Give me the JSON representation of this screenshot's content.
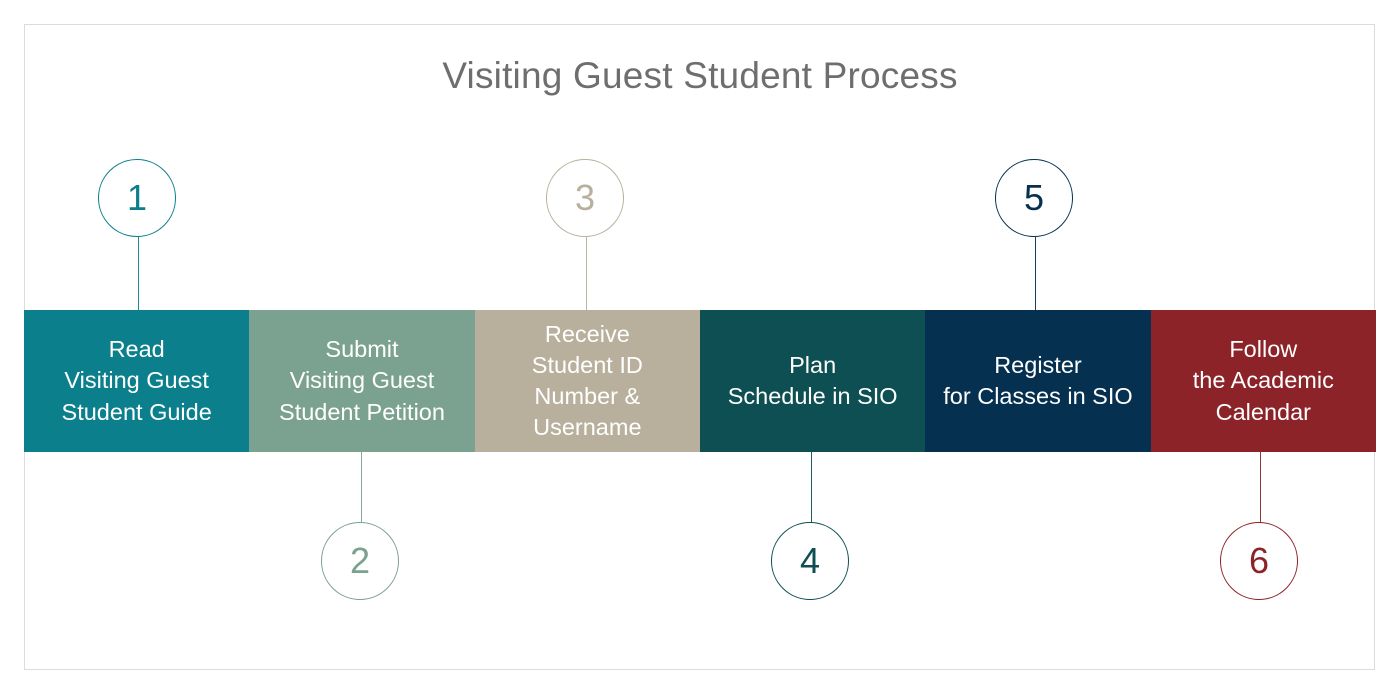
{
  "page": {
    "title": "Visiting Guest Student Process",
    "background": "#ffffff",
    "frame_border_color": "#dcdcdc",
    "title_color": "#6e6e6e"
  },
  "chart_data": {
    "type": "table",
    "title": "Visiting Guest Student Process",
    "steps": [
      {
        "number": "1",
        "label": "Read\nVisiting Guest\nStudent Guide",
        "color": "#0b7f8c",
        "marker_position": "above"
      },
      {
        "number": "2",
        "label": "Submit\nVisiting Guest\nStudent Petition",
        "color": "#7ba191",
        "marker_position": "below"
      },
      {
        "number": "3",
        "label": "Receive\nStudent ID\nNumber &\nUsername",
        "color": "#b8b09c",
        "marker_position": "above"
      },
      {
        "number": "4",
        "label": "Plan\nSchedule in SIO",
        "color": "#0d4f52",
        "marker_position": "below"
      },
      {
        "number": "5",
        "label": "Register\nfor Classes in SIO",
        "color": "#05304f",
        "marker_position": "above"
      },
      {
        "number": "6",
        "label": "Follow\nthe Academic\nCalendar",
        "color": "#8c2328",
        "marker_position": "below"
      }
    ]
  },
  "steps": {
    "s1": {
      "number": "1",
      "label": "Read\nVisiting Guest\nStudent Guide"
    },
    "s2": {
      "number": "2",
      "label": "Submit\nVisiting Guest\nStudent Petition"
    },
    "s3": {
      "number": "3",
      "label": "Receive\nStudent ID\nNumber &\nUsername"
    },
    "s4": {
      "number": "4",
      "label": "Plan\nSchedule in SIO"
    },
    "s5": {
      "number": "5",
      "label": "Register\nfor Classes in SIO"
    },
    "s6": {
      "number": "6",
      "label": "Follow\nthe Academic\nCalendar"
    }
  }
}
